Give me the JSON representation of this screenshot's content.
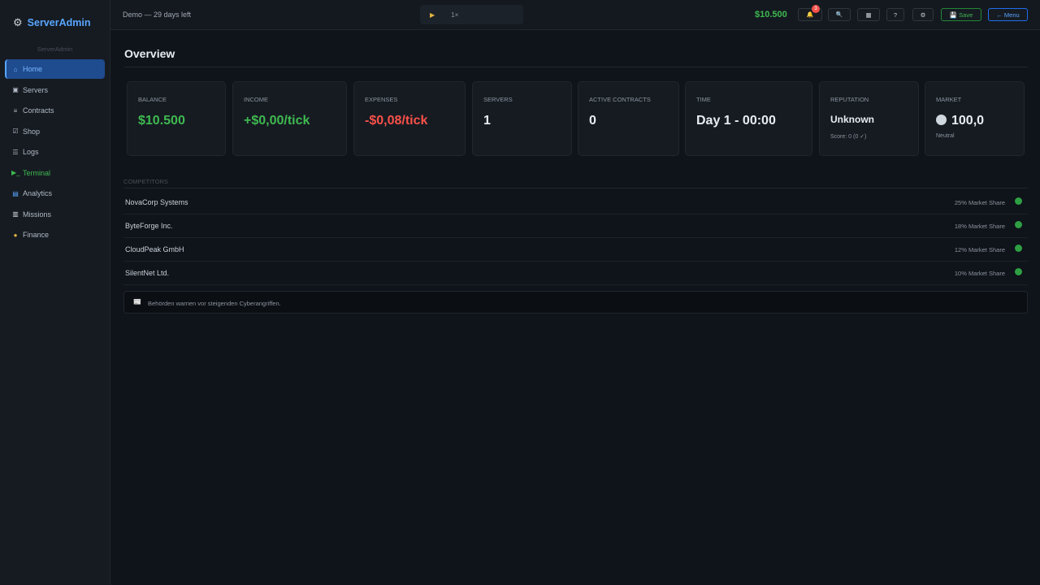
{
  "app": {
    "name": "ServerAdmin",
    "subtitle": "ServerAdmin"
  },
  "sidebar": {
    "items": [
      {
        "icon": "⌂",
        "label": "Home"
      },
      {
        "icon": "▣",
        "label": "Servers"
      },
      {
        "icon": "≡",
        "label": "Contracts"
      },
      {
        "icon": "☑",
        "label": "Shop"
      },
      {
        "icon": "☰",
        "label": "Logs"
      },
      {
        "icon": "▶_",
        "label": "Terminal"
      },
      {
        "icon": "▤",
        "label": "Analytics"
      },
      {
        "icon": "▥",
        "label": "Missions"
      },
      {
        "icon": "●",
        "label": "Finance"
      }
    ]
  },
  "topbar": {
    "demo_text": "Demo — 29 days left",
    "play_icon": "▶",
    "speed": "1×",
    "balance": "$10.500",
    "notification_count": "3",
    "bell_icon": "🔔",
    "search_icon": "🔍",
    "grid_icon": "▦",
    "help_icon": "?",
    "settings_icon": "⚙",
    "save_label": "💾 Save",
    "menu_label": "← Menu"
  },
  "main": {
    "title": "Overview",
    "stats": [
      {
        "label": "Balance",
        "value": "$10.500"
      },
      {
        "label": "Income",
        "value": "+$0,00/tick"
      },
      {
        "label": "Expenses",
        "value": "-$0,08/tick"
      },
      {
        "label": "Servers",
        "value": "1"
      },
      {
        "label": "Active Contracts",
        "value": "0"
      },
      {
        "label": "Time",
        "value": "Day 1 - 00:00"
      },
      {
        "label": "Reputation",
        "value": "Unknown",
        "sub": "Score: 0  (0 ✓)"
      },
      {
        "label": "Market",
        "value": "100,0",
        "sub": "Neutral"
      }
    ],
    "competitors_heading": "Competitors",
    "competitors": [
      {
        "name": "NovaCorp Systems",
        "share": "25% Market Share"
      },
      {
        "name": "ByteForge Inc.",
        "share": "18% Market Share"
      },
      {
        "name": "CloudPeak GmbH",
        "share": "12% Market Share"
      },
      {
        "name": "SilentNet Ltd.",
        "share": "10% Market Share"
      }
    ],
    "news_icon": "📰",
    "news_text": "Behörden warnen vor steigenden Cyberangriffen."
  },
  "colors": {
    "accent": "#58a6ff",
    "positive": "#3fb950",
    "negative": "#f85149",
    "background": "#0f131a"
  }
}
